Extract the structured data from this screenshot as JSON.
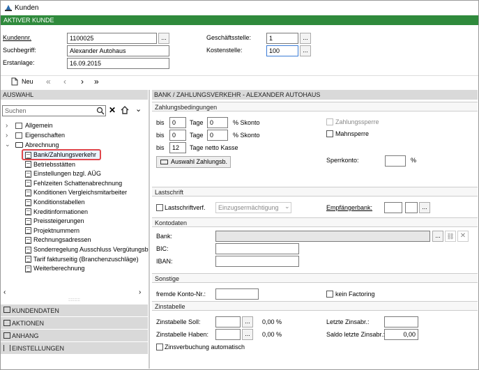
{
  "window": {
    "title": "Kunden"
  },
  "banner": "AKTIVER KUNDE",
  "header": {
    "kundennr_label": "Kundennr.",
    "kundennr_value": "1100025",
    "suchbegriff_label": "Suchbegriff:",
    "suchbegriff_value": "Alexander Autohaus",
    "erstanlage_label": "Erstanlage:",
    "erstanlage_value": "16.09.2015",
    "geschaeftsstelle_label": "Geschäftsstelle:",
    "geschaeftsstelle_value": "1",
    "kostenstelle_label": "Kostenstelle:",
    "kostenstelle_value": "100",
    "dots": "..."
  },
  "toolbar": {
    "new_label": "Neu",
    "first": "«",
    "prev": "‹",
    "next": "›",
    "last": "»"
  },
  "left": {
    "section_title": "AUSWAHL",
    "search_placeholder": "Suchen",
    "tree": [
      {
        "label": "Allgemein"
      },
      {
        "label": "Eigenschaften"
      },
      {
        "label": "Abrechnung"
      }
    ],
    "children": [
      "Bank/Zahlungsverkehr",
      "Betriebsstätten",
      "Einstellungen bzgl. AÜG",
      "Fehlzeiten Schattenabrechnung",
      "Konditionen Vergleichsmitarbeiter",
      "Konditionstabellen",
      "Kreditinformationen",
      "Preissteigerungen",
      "Projektnummern",
      "Rechnungsadressen",
      "Sonderregelung Ausschluss Vergütungsb",
      "Tarif fakturseitig (Branchenzuschläge)",
      "Weiterberechnung"
    ],
    "nav": [
      "KUNDENDATEN",
      "AKTIONEN",
      "ANHANG",
      "EINSTELLUNGEN"
    ]
  },
  "right": {
    "section_title": "BANK / ZAHLUNGSVERKEHR - ALEXANDER AUTOHAUS",
    "zahlung": {
      "head": "Zahlungsbedingungen",
      "bis": "bis",
      "tage": "Tage",
      "skonto": "% Skonto",
      "netto": "Tage netto Kasse",
      "r1_days": "0",
      "r1_pct": "0",
      "r2_days": "0",
      "r2_pct": "0",
      "r3_days": "12",
      "auswahl_btn": "Auswahl Zahlungsb.",
      "zahlungssperre": "Zahlungssperre",
      "mahnsperre": "Mahnsperre",
      "sperrkonto": "Sperrkonto:",
      "percent": "%"
    },
    "lastschrift": {
      "head": "Lastschrift",
      "lastschriftverf": "Lastschriftverf.",
      "dropdown": "Einzugsermächtigung",
      "empfaengerbank": "Empfängerbank:"
    },
    "konto": {
      "head": "Kontodaten",
      "bank": "Bank:",
      "bic": "BIC:",
      "iban": "IBAN:"
    },
    "sonstige": {
      "head": "Sonstige",
      "fremde": "fremde Konto-Nr.:",
      "factoring": "kein Factoring"
    },
    "zins": {
      "head": "Zinstabelle",
      "soll": "Zinstabelle Soll:",
      "soll_pct": "0,00 %",
      "haben": "Zinstabelle Haben:",
      "haben_pct": "0,00 %",
      "letzte": "Letzte Zinsabr.:",
      "saldo": "Saldo letzte Zinsabr.:",
      "saldo_value": "0,00",
      "verbuchung": "Zinsverbuchung automatisch"
    }
  },
  "colors": {
    "banner": "#2f8a3c",
    "section": "#d9d9d9",
    "highlight": "#e0474c"
  }
}
